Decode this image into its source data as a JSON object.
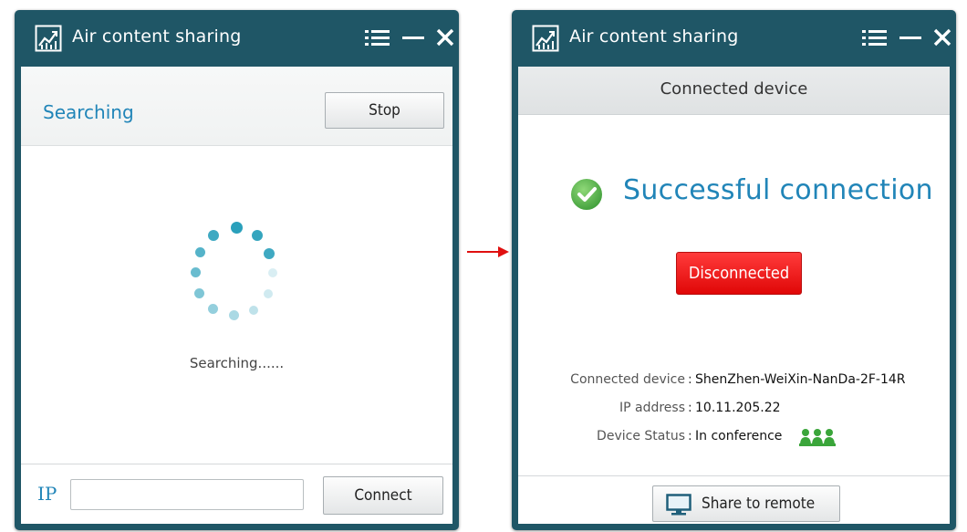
{
  "left_window": {
    "title": "Air content sharing",
    "header_title": "Searching",
    "stop_label": "Stop",
    "status_text": "Searching......",
    "ip_label": "IP",
    "ip_value": "",
    "connect_label": "Connect"
  },
  "right_window": {
    "title": "Air content sharing",
    "header_label": "Connected device",
    "success_text": "Successful connection",
    "disconnect_label": "Disconnected",
    "info": {
      "device_key": "Connected device",
      "device_value": "ShenZhen-WeiXin-NanDa-2F-14R",
      "ip_key": "IP address",
      "ip_value": "10.11.205.22",
      "status_key": "Device Status",
      "status_value": "In conference",
      "separator": ":"
    },
    "share_label": "Share to remote"
  },
  "icons": {
    "app": "chart-icon",
    "menu": "menu-icon",
    "minimize": "minimize-icon",
    "close": "close-icon",
    "success": "check-circle-icon",
    "conference": "people-icon",
    "share": "monitor-icon"
  },
  "colors": {
    "titlebar": "#1f5666",
    "accent_blue": "#2185b8",
    "spinner": "#2aa0bb",
    "disconnect_red": "#ee1b1b",
    "success_green": "#5cb85c",
    "conference_green": "#3aa53a",
    "arrow_red": "#e01010"
  }
}
